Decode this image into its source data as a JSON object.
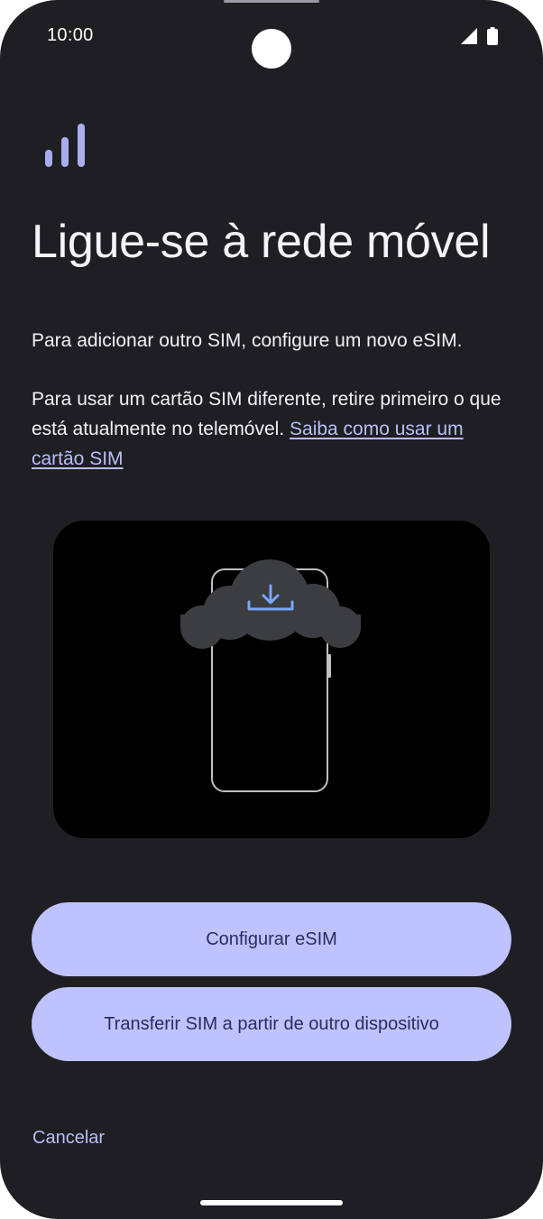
{
  "status_bar": {
    "time": "10:00",
    "icons": [
      "signal-icon",
      "battery-icon"
    ]
  },
  "header": {
    "icon": "signal-bars-icon",
    "title": "Ligue-se à rede móvel"
  },
  "body": {
    "paragraph1": "Para adicionar outro SIM, configure um novo eSIM.",
    "paragraph2": "Para usar um cartão SIM diferente, retire primeiro o que está atualmente no telemóvel. ",
    "help_link": "Saiba como usar um cartão SIM"
  },
  "illustration": {
    "icon": "esim-download-phone-illustration"
  },
  "buttons": {
    "configure_esim": "Configurar eSIM",
    "transfer_sim": "Transferir SIM a partir de outro dispositivo"
  },
  "footer": {
    "cancel": "Cancelar"
  },
  "colors": {
    "background": "#1f1f23",
    "accent": "#bec2ff",
    "link": "#b9bdfb",
    "icon_purple": "#a9adf0",
    "download_blue": "#7aa7f5"
  }
}
